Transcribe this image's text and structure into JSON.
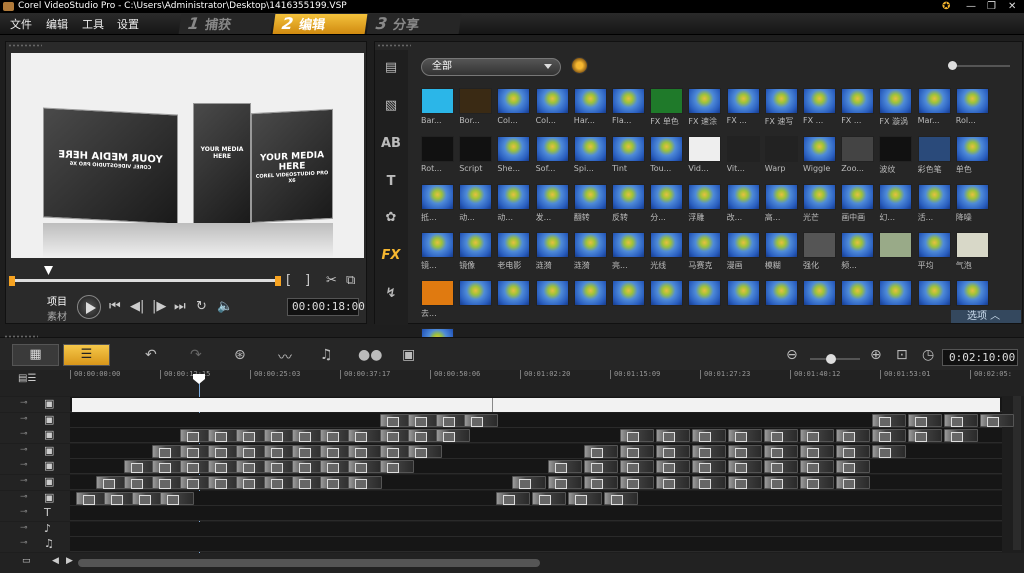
{
  "titlebar": {
    "title": "Corel VideoStudio Pro - C:\\Users\\Administrator\\Desktop\\1416355199.VSP"
  },
  "menu": {
    "items": [
      "文件",
      "编辑",
      "工具",
      "设置"
    ]
  },
  "steps": [
    {
      "num": "1",
      "label": "捕获"
    },
    {
      "num": "2",
      "label": "编辑"
    },
    {
      "num": "3",
      "label": "分享"
    }
  ],
  "preview": {
    "card_text_1": "YOUR MEDIA HERE",
    "card_text_2": "COREL VIDEOSTUDIO PRO X6",
    "mode_project": "项目",
    "mode_clip": "素材",
    "timecode": "00:00:18:00"
  },
  "library": {
    "category": "全部",
    "options_label": "选项",
    "tiles": [
      "Bar...",
      "Bor...",
      "Col...",
      "Col...",
      "Har...",
      "Fla...",
      "FX 单色",
      "FX 速涂",
      "FX ...",
      "FX 速写",
      "FX ...",
      "FX ...",
      "FX 漩涡",
      "Mar...",
      "Rol...",
      "Rot...",
      "Script",
      "She...",
      "Sof...",
      "Spi...",
      "Tint",
      "Tou...",
      "Vid...",
      "Vit...",
      "Warp",
      "Wiggle",
      "Zoo...",
      "波纹",
      "彩色笔",
      "单色",
      "抵...",
      "动...",
      "动...",
      "发...",
      "翻转",
      "反转",
      "分...",
      "浮雕",
      "改...",
      "高...",
      "光芒",
      "画中画",
      "幻...",
      "活...",
      "降噪",
      "镜...",
      "镜像",
      "老电影",
      "涟漪",
      "涟漪",
      "亮...",
      "光线",
      "马赛克",
      "漫画",
      "模糊",
      "强化",
      "频...",
      "",
      "平均",
      "气泡",
      "去...",
      "",
      "",
      "",
      "",
      "",
      "",
      "",
      "",
      "",
      "",
      "",
      "",
      "",
      "",
      ""
    ]
  },
  "timeline": {
    "timecode": "0:02:10:00",
    "ruler": [
      "00:00:00:00",
      "00:00:12:15",
      "00:00:25:03",
      "00:00:37:17",
      "00:00:50:06",
      "00:01:02:20",
      "00:01:15:09",
      "00:01:27:23",
      "00:01:40:12",
      "00:01:53:01",
      "00:02:05:"
    ]
  },
  "colors": {
    "accent": "#f6b730",
    "playhead": "#7faee0"
  }
}
